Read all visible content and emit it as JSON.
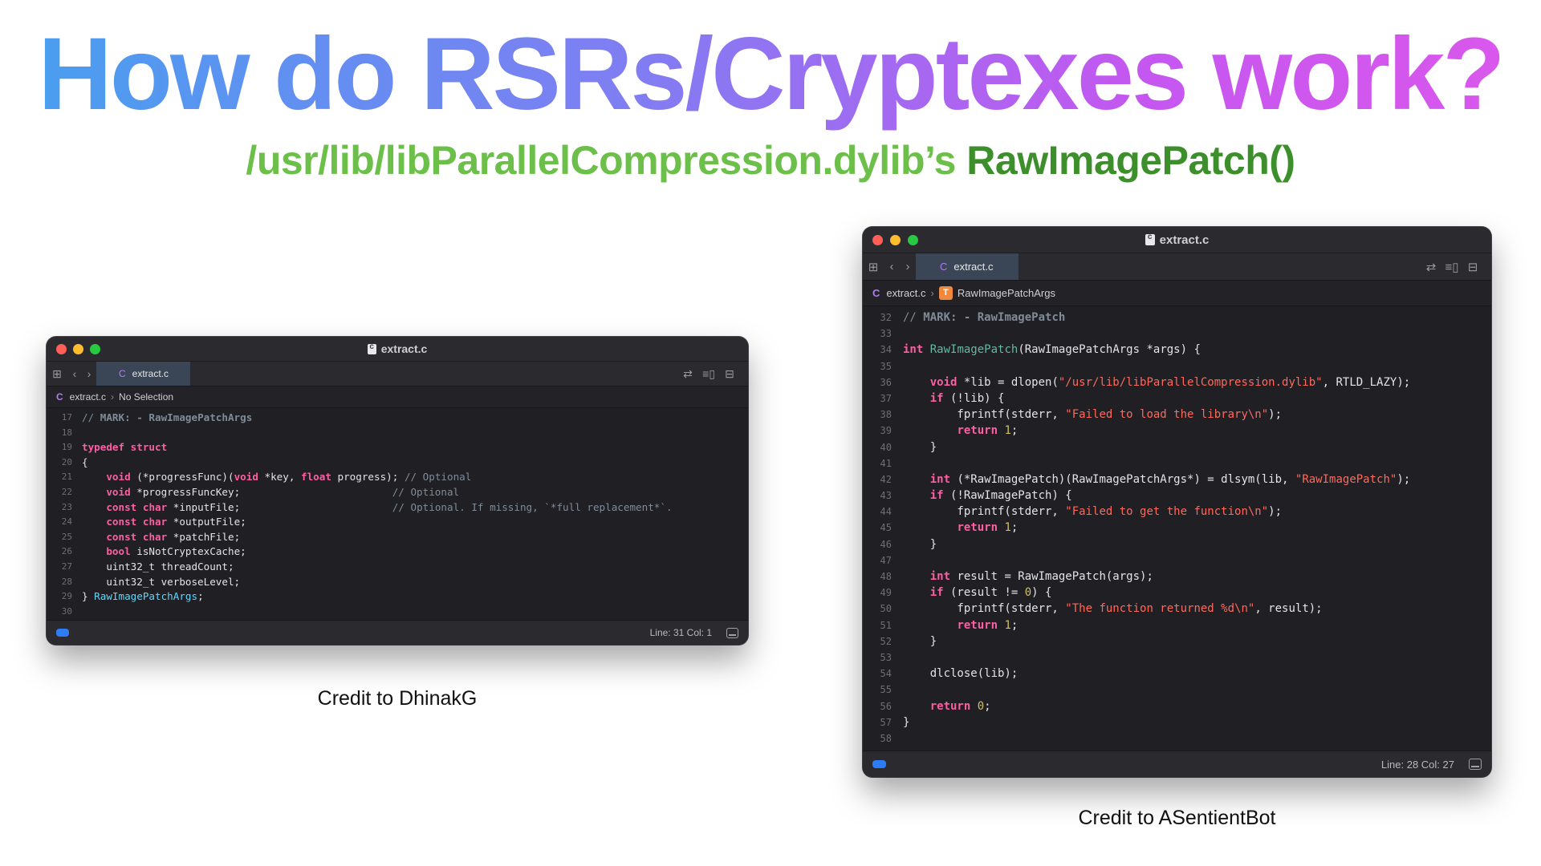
{
  "slide": {
    "title": "How do RSRs/Cryptexes work?",
    "subtitle_path": "/usr/lib/libParallelCompression.dylib’s",
    "subtitle_func": "RawImagePatch()",
    "caption_left": "Credit to DhinakG",
    "caption_right": "Credit to ASentientBot"
  },
  "left_window": {
    "title": "extract.c",
    "tab_label": "extract.c",
    "tab_icon": "C",
    "breadcrumb_file": "extract.c",
    "breadcrumb_symbol": "No Selection",
    "status": "Line: 31  Col: 1",
    "code_lines": [
      {
        "n": "17",
        "html": "<span class=\"cm\">// </span><span class=\"mk\">MARK: - RawImagePatchArgs</span>"
      },
      {
        "n": "18",
        "html": ""
      },
      {
        "n": "19",
        "html": "<span class=\"kw\">typedef</span> <span class=\"kw\">struct</span>"
      },
      {
        "n": "20",
        "html": "{"
      },
      {
        "n": "21",
        "html": "    <span class=\"kw\">void</span> (*progressFunc)(<span class=\"kw\">void</span> *key, <span class=\"kw\">float</span> progress); <span class=\"cm\">// Optional</span>"
      },
      {
        "n": "22",
        "html": "    <span class=\"kw\">void</span> *progressFuncKey;                         <span class=\"cm\">// Optional</span>"
      },
      {
        "n": "23",
        "html": "    <span class=\"kw\">const</span> <span class=\"kw\">char</span> *inputFile;                         <span class=\"cm\">// Optional. If missing, `*full replacement*`.</span>"
      },
      {
        "n": "24",
        "html": "    <span class=\"kw\">const</span> <span class=\"kw\">char</span> *outputFile;"
      },
      {
        "n": "25",
        "html": "    <span class=\"kw\">const</span> <span class=\"kw\">char</span> *patchFile;"
      },
      {
        "n": "26",
        "html": "    <span class=\"kw\">bool</span> isNotCryptexCache;"
      },
      {
        "n": "27",
        "html": "    uint32_t threadCount;"
      },
      {
        "n": "28",
        "html": "    uint32_t verboseLevel;"
      },
      {
        "n": "29",
        "html": "} <span class=\"ty\">RawImagePatchArgs</span>;"
      },
      {
        "n": "30",
        "html": ""
      }
    ]
  },
  "right_window": {
    "title": "extract.c",
    "tab_label": "extract.c",
    "tab_icon": "C",
    "breadcrumb_file": "extract.c",
    "breadcrumb_badge": "T",
    "breadcrumb_symbol": "RawImagePatchArgs",
    "status": "Line: 28  Col: 27",
    "code_lines": [
      {
        "n": "32",
        "html": "<span class=\"cm\">// </span><span class=\"mk\">MARK: - RawImagePatch</span>"
      },
      {
        "n": "33",
        "html": ""
      },
      {
        "n": "34",
        "html": "<span class=\"kw\">int</span> <span class=\"fn\">RawImagePatch</span>(RawImagePatchArgs *args) {"
      },
      {
        "n": "35",
        "html": ""
      },
      {
        "n": "36",
        "html": "    <span class=\"kw\">void</span> *lib = dlopen(<span class=\"str\">\"/usr/lib/libParallelCompression.dylib\"</span>, RTLD_LAZY);"
      },
      {
        "n": "37",
        "html": "    <span class=\"kw\">if</span> (!lib) {"
      },
      {
        "n": "38",
        "html": "        fprintf(stderr, <span class=\"str\">\"Failed to load the library\\n\"</span>);"
      },
      {
        "n": "39",
        "html": "        <span class=\"kw\">return</span> <span class=\"num\">1</span>;"
      },
      {
        "n": "40",
        "html": "    }"
      },
      {
        "n": "41",
        "html": ""
      },
      {
        "n": "42",
        "html": "    <span class=\"kw\">int</span> (*RawImagePatch)(RawImagePatchArgs*) = dlsym(lib, <span class=\"str\">\"RawImagePatch\"</span>);"
      },
      {
        "n": "43",
        "html": "    <span class=\"kw\">if</span> (!RawImagePatch) {"
      },
      {
        "n": "44",
        "html": "        fprintf(stderr, <span class=\"str\">\"Failed to get the function\\n\"</span>);"
      },
      {
        "n": "45",
        "html": "        <span class=\"kw\">return</span> <span class=\"num\">1</span>;"
      },
      {
        "n": "46",
        "html": "    }"
      },
      {
        "n": "47",
        "html": ""
      },
      {
        "n": "48",
        "html": "    <span class=\"kw\">int</span> result = RawImagePatch(args);"
      },
      {
        "n": "49",
        "html": "    <span class=\"kw\">if</span> (result != <span class=\"num\">0</span>) {"
      },
      {
        "n": "50",
        "html": "        fprintf(stderr, <span class=\"str\">\"The function returned %d\\n\"</span>, result);"
      },
      {
        "n": "51",
        "html": "        <span class=\"kw\">return</span> <span class=\"num\">1</span>;"
      },
      {
        "n": "52",
        "html": "    }"
      },
      {
        "n": "53",
        "html": ""
      },
      {
        "n": "54",
        "html": "    dlclose(lib);"
      },
      {
        "n": "55",
        "html": ""
      },
      {
        "n": "56",
        "html": "    <span class=\"kw\">return</span> <span class=\"num\">0</span>;"
      },
      {
        "n": "57",
        "html": "}"
      },
      {
        "n": "58",
        "html": ""
      }
    ]
  },
  "icons": {
    "grid": "⊞",
    "back": "‹",
    "forward": "›",
    "swap": "⇄",
    "minimap": "≡▯",
    "add_panel": "⊟",
    "chevron": "›"
  },
  "colors": {
    "title_gradient": [
      "#4a9ef0",
      "#7f7ef2",
      "#c457f0",
      "#d957ec"
    ],
    "subtitle_light_green": "#6cc04a",
    "subtitle_dark_green": "#3c8f2b",
    "editor_bg": "#1f1f24",
    "keyword": "#fc5fa3",
    "string": "#fc6a5d",
    "number": "#d0bf69",
    "comment": "#7f8c98"
  }
}
